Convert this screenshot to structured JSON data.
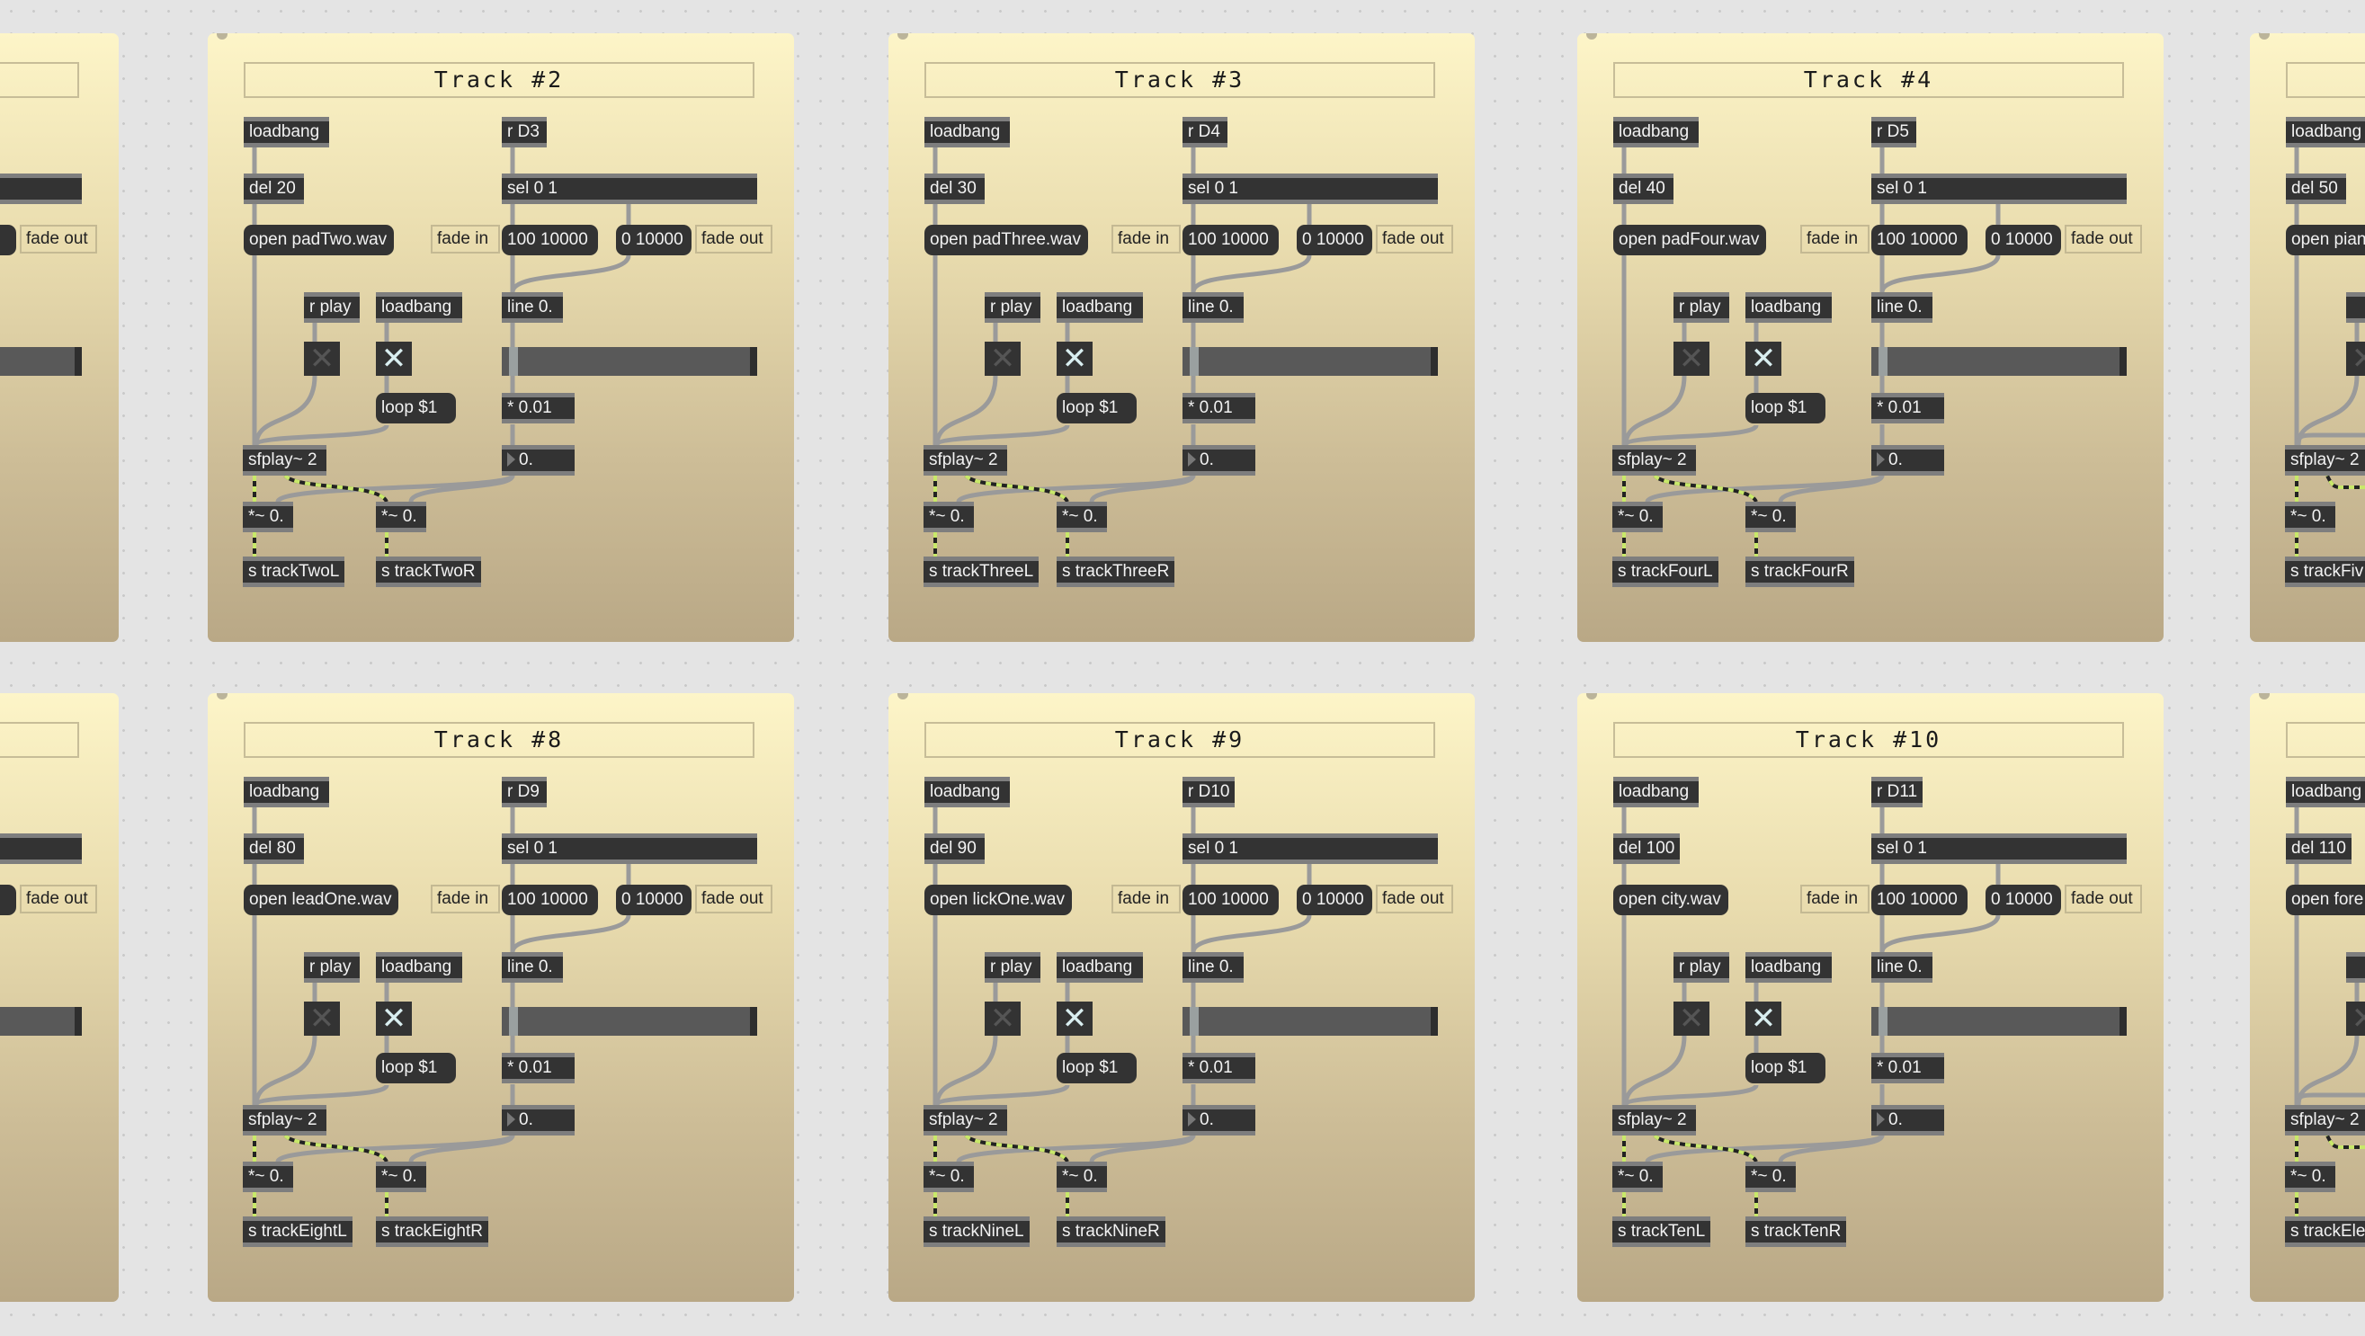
{
  "common": {
    "loadbang": "loadbang",
    "sel": "sel 0 1",
    "fade_in": "fade in",
    "fade_out": "fade out",
    "fade_in_msg": "100 10000",
    "fade_out_msg": "0 10000",
    "r_play": "r play",
    "line": "line 0.",
    "loop": "loop $1",
    "mult": "* 0.01",
    "sfplay": "sfplay~ 2",
    "number": "0.",
    "sigmult": "*~ 0."
  },
  "colors": {
    "panel_top": "#fdf5c8",
    "panel_bottom": "#b9a886",
    "object": "#333333",
    "signal_cord": "#c8e86a"
  },
  "panels": [
    {
      "title": "",
      "del": "",
      "open": "",
      "receive": "",
      "sendL": "",
      "sendR": ""
    },
    {
      "title": "Track #2",
      "del": "del 20",
      "open": "open padTwo.wav",
      "receive": "r D3",
      "sendL": "s trackTwoL",
      "sendR": "s trackTwoR"
    },
    {
      "title": "Track #3",
      "del": "del 30",
      "open": "open padThree.wav",
      "receive": "r D4",
      "sendL": "s trackThreeL",
      "sendR": "s trackThreeR"
    },
    {
      "title": "Track #4",
      "del": "del 40",
      "open": "open padFour.wav",
      "receive": "r D5",
      "sendL": "s trackFourL",
      "sendR": "s trackFourR"
    },
    {
      "title": "",
      "del": "del 50",
      "open": "open pian",
      "receive": "",
      "sendL": "s trackFiv",
      "sendR": ""
    },
    {
      "title": "",
      "del": "",
      "open": "",
      "receive": "",
      "sendL": "",
      "sendR": ""
    },
    {
      "title": "Track #8",
      "del": "del 80",
      "open": "open leadOne.wav",
      "receive": "r D9",
      "sendL": "s trackEightL",
      "sendR": "s trackEightR"
    },
    {
      "title": "Track #9",
      "del": "del 90",
      "open": "open lickOne.wav",
      "receive": "r D10",
      "sendL": "s trackNineL",
      "sendR": "s trackNineR"
    },
    {
      "title": "Track #10",
      "del": "del 100",
      "open": "open city.wav",
      "receive": "r D11",
      "sendL": "s trackTenL",
      "sendR": "s trackTenR"
    },
    {
      "title": "",
      "del": "del 110",
      "open": "open fore",
      "receive": "",
      "sendL": "s trackEle",
      "sendR": ""
    }
  ]
}
